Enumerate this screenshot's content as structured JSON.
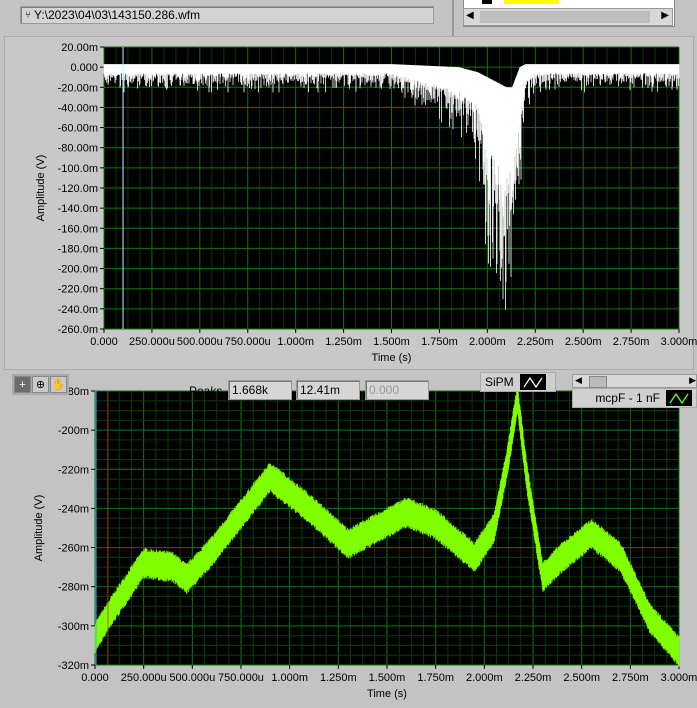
{
  "file_path": "Y:\\2023\\04\\03\\143150.286.wfm",
  "peaks": {
    "label": "Peaks",
    "values": [
      "1.668k",
      "12.41m",
      "0.000"
    ]
  },
  "legend": [
    {
      "name": "SiPM",
      "color": "#ffffff"
    },
    {
      "name": "mcpF - 1 nF",
      "color": "#7fff00"
    }
  ],
  "colors": {
    "grid_major": "#0a7a0a",
    "grid_minor": "#063c06",
    "plot_bg": "#000000",
    "trace1": "#ffffff",
    "trace2": "#7fff00",
    "cursor1": "#9fffff"
  },
  "chart_data": [
    {
      "type": "line",
      "title": "",
      "xlabel": "Time (s)",
      "ylabel": "Amplitude (V)",
      "xlim": [
        0,
        0.003
      ],
      "ylim": [
        -0.26,
        0.02
      ],
      "xticks": [
        "0.000",
        "250.000u",
        "500.000u",
        "750.000u",
        "1.000m",
        "1.250m",
        "1.500m",
        "1.750m",
        "2.000m",
        "2.250m",
        "2.500m",
        "2.750m",
        "3.000m"
      ],
      "yticks": [
        "20.00m",
        "0.000",
        "-20.00m",
        "-40.00m",
        "-60.00m",
        "-80.00m",
        "-100.0m",
        "-120.0m",
        "-140.0m",
        "-160.0m",
        "-180.0m",
        "-200.0m",
        "-220.0m",
        "-240.0m",
        "-260.0m"
      ],
      "series": [
        {
          "name": "SiPM",
          "x_ms": [
            0,
            0.5,
            1.0,
            1.5,
            1.85,
            1.95,
            2.0,
            2.05,
            2.1,
            2.13,
            2.17,
            2.2,
            2.25,
            3.0
          ],
          "min": [
            -0.02,
            -0.02,
            -0.02,
            -0.02,
            -0.06,
            -0.09,
            -0.19,
            -0.2,
            -0.24,
            -0.22,
            -0.13,
            -0.04,
            -0.02,
            -0.02
          ],
          "max": [
            0.003,
            0.003,
            0.003,
            0.003,
            0.0,
            -0.005,
            -0.01,
            -0.015,
            -0.02,
            -0.02,
            0.0,
            0.003,
            0.003,
            0.003
          ]
        }
      ]
    },
    {
      "type": "line",
      "title": "",
      "xlabel": "Time (s)",
      "ylabel": "Amplitude (V)",
      "xlim": [
        0,
        0.003
      ],
      "ylim": [
        -0.32,
        -0.18
      ],
      "xticks": [
        "0.000",
        "250.000u",
        "500.000u",
        "750.000u",
        "1.000m",
        "1.250m",
        "1.500m",
        "1.750m",
        "2.000m",
        "2.250m",
        "2.500m",
        "2.750m",
        "3.000m"
      ],
      "yticks": [
        "-180m",
        "-200m",
        "-220m",
        "-240m",
        "-260m",
        "-280m",
        "-300m",
        "-320m"
      ],
      "series": [
        {
          "name": "mcpF - 1 nF",
          "x_ms": [
            0,
            0.1,
            0.25,
            0.4,
            0.47,
            0.6,
            0.9,
            1.1,
            1.3,
            1.45,
            1.6,
            1.75,
            1.95,
            2.05,
            2.12,
            2.17,
            2.22,
            2.3,
            2.4,
            2.55,
            2.7,
            2.85,
            3.0
          ],
          "y": [
            -0.306,
            -0.29,
            -0.268,
            -0.27,
            -0.276,
            -0.262,
            -0.224,
            -0.24,
            -0.258,
            -0.25,
            -0.242,
            -0.248,
            -0.265,
            -0.25,
            -0.215,
            -0.184,
            -0.225,
            -0.275,
            -0.265,
            -0.253,
            -0.265,
            -0.296,
            -0.313
          ]
        }
      ]
    }
  ]
}
